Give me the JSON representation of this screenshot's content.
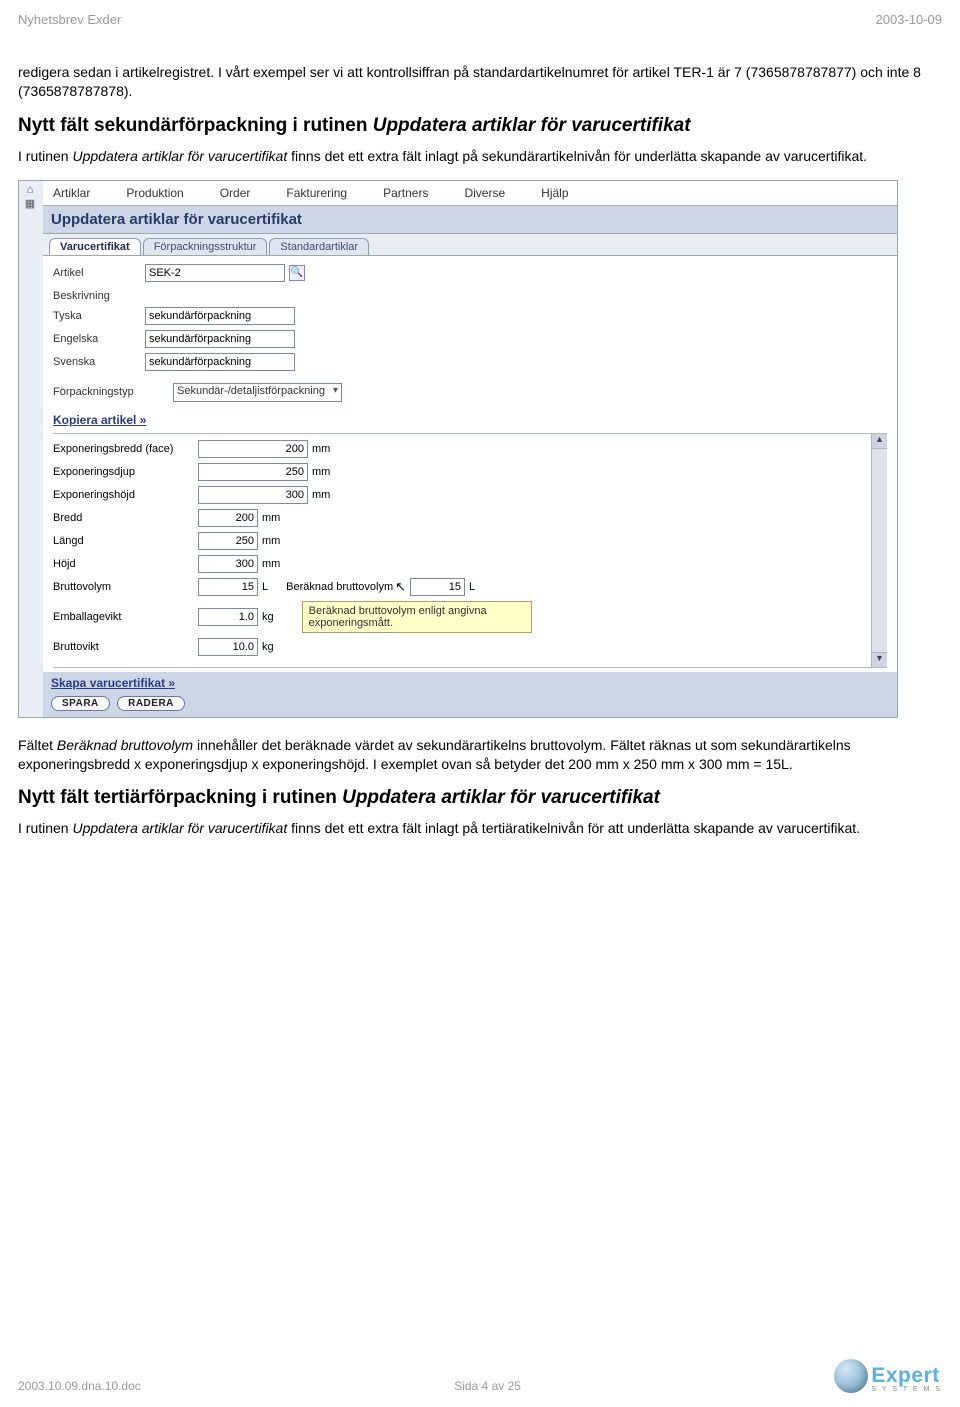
{
  "header": {
    "left": "Nyhetsbrev Exder",
    "right": "2003-10-09"
  },
  "intro_paragraph": "redigera sedan i artikelregistret. I vårt exempel ser vi att kontrollsiffran på standardartikelnumret för artikel TER-1 är 7 (7365878787877) och inte 8 (7365878787878).",
  "section1": {
    "heading_prefix": "Nytt fält sekundärförpackning i rutinen ",
    "heading_ital": "Uppdatera artiklar för varucertifikat",
    "body_a": "I rutinen ",
    "body_ital": "Uppdatera artiklar för varucertifikat",
    "body_b": " finns det ett extra fält inlagt på sekundärartikelnivån för underlätta skapande av varucertifikat."
  },
  "app": {
    "menubar": [
      "Artiklar",
      "Produktion",
      "Order",
      "Fakturering",
      "Partners",
      "Diverse",
      "Hjälp"
    ],
    "panel_title": "Uppdatera artiklar för varucertifikat",
    "tabs": [
      "Varucertifikat",
      "Förpackningsstruktur",
      "Standardartiklar"
    ],
    "form": {
      "article_label": "Artikel",
      "article_value": "SEK-2",
      "desc_label": "Beskrivning",
      "langs": {
        "tyska_label": "Tyska",
        "tyska_value": "sekundärförpackning",
        "engelska_label": "Engelska",
        "engelska_value": "sekundärförpackning",
        "svenska_label": "Svenska",
        "svenska_value": "sekundärförpackning"
      },
      "packtype_label": "Förpackningstyp",
      "packtype_value": "Sekundär-/detaljistförpackning",
      "copy_link": "Kopiera artikel »"
    },
    "measures": [
      {
        "label": "Exponeringsbredd (face)",
        "value": "200",
        "unit": "mm"
      },
      {
        "label": "Exponeringsdjup",
        "value": "250",
        "unit": "mm"
      },
      {
        "label": "Exponeringshöjd",
        "value": "300",
        "unit": "mm"
      },
      {
        "label": "Bredd",
        "value": "200",
        "unit": "mm"
      },
      {
        "label": "Längd",
        "value": "250",
        "unit": "mm"
      },
      {
        "label": "Höjd",
        "value": "300",
        "unit": "mm"
      },
      {
        "label": "Bruttovolym",
        "value": "15",
        "unit": "L"
      },
      {
        "label": "Emballagevikt",
        "value": "1.0",
        "unit": "kg"
      },
      {
        "label": "Bruttovikt",
        "value": "10.0",
        "unit": "kg"
      }
    ],
    "calc": {
      "label": "Beräknad bruttovolym",
      "value": "15",
      "unit": "L",
      "tooltip": "Beräknad bruttovolym enligt angivna exponeringsmått."
    },
    "bottom": {
      "create_link": "Skapa varucertifikat »",
      "btn_save": "SPARA",
      "btn_delete": "RADERA"
    }
  },
  "after_shot": {
    "p1a": "Fältet ",
    "p1_ital": "Beräknad bruttovolym",
    "p1b": " innehåller det beräknade värdet av sekundärartikelns bruttovolym. Fältet räknas ut som sekundärartikelns exponeringsbredd x exponeringsdjup x exponeringshöjd. I exemplet ovan så betyder det 200 mm x 250 mm x 300 mm = 15L."
  },
  "section2": {
    "heading_prefix": "Nytt fält tertiärförpackning i rutinen ",
    "heading_ital": "Uppdatera artiklar för varucertifikat",
    "body_a": "I rutinen ",
    "body_ital": "Uppdatera artiklar för varucertifikat",
    "body_b": " finns det ett extra fält inlagt på tertiäratikelnivån för att underlätta skapande av varucertifikat."
  },
  "footer": {
    "file": "2003.10.09.dna.10.doc",
    "page": "Sida 4 av 25",
    "logo_word": "Expert",
    "logo_sub": "S Y S T E M S"
  }
}
